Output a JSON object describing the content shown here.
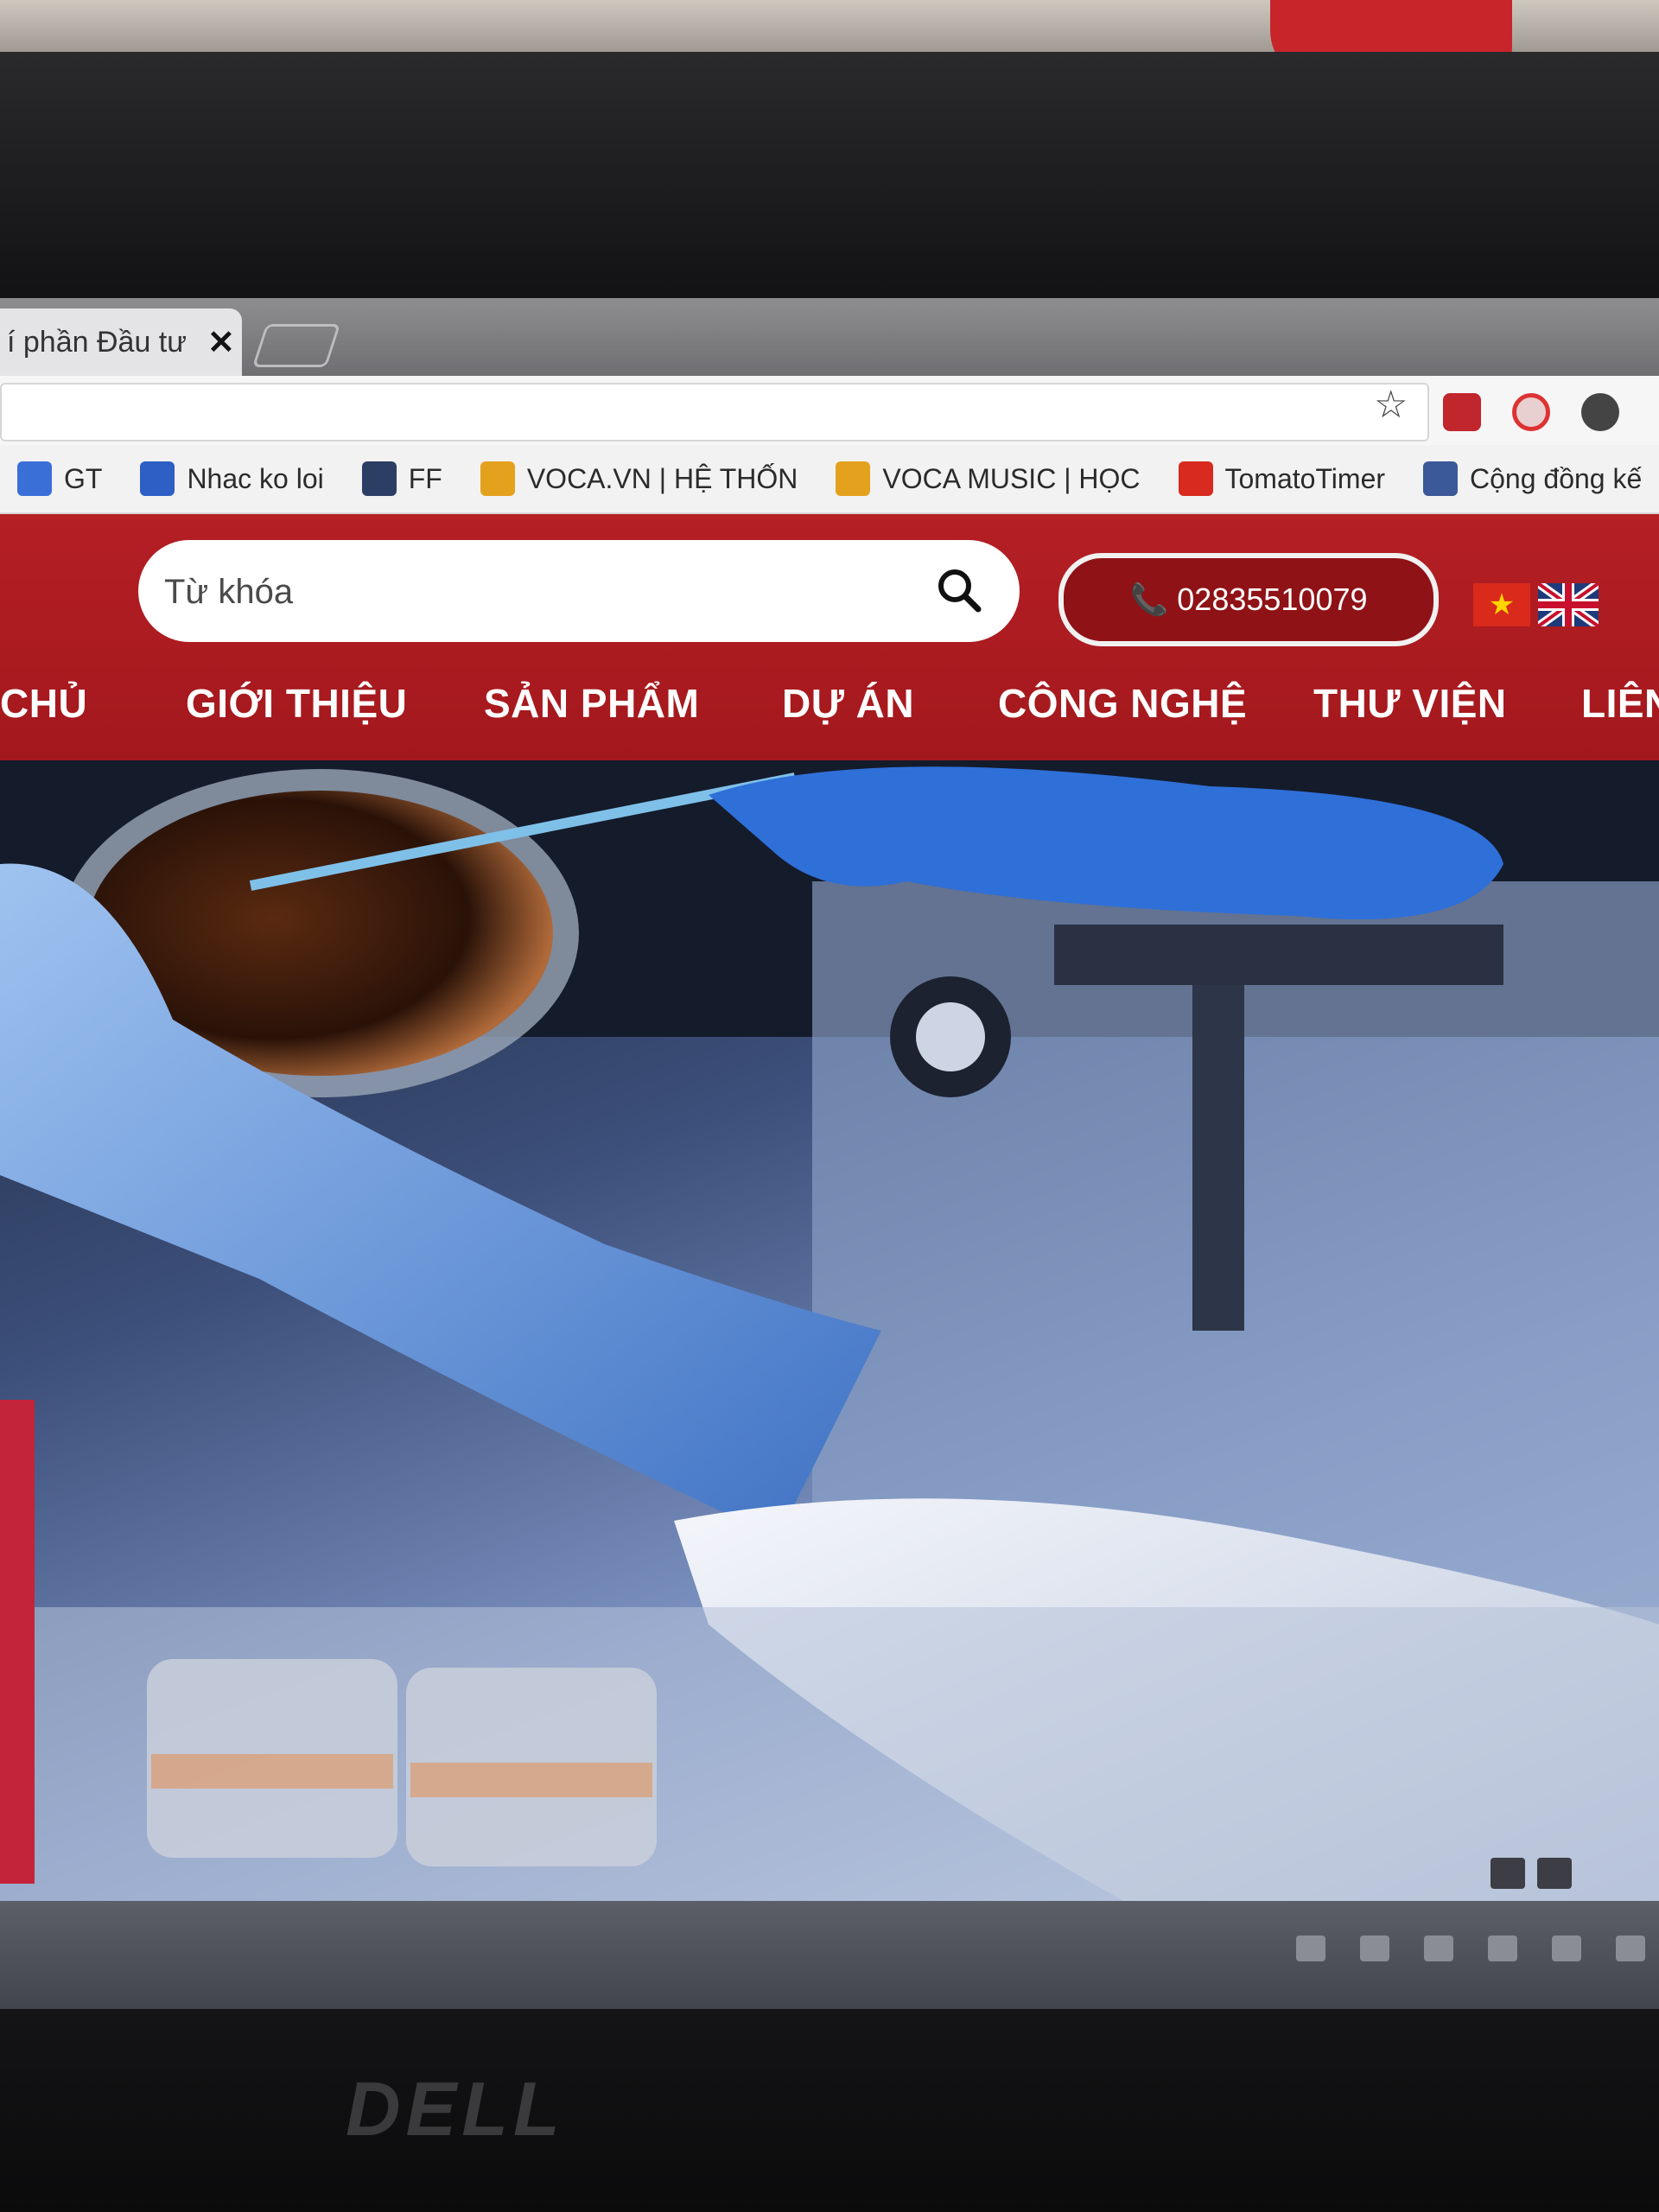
{
  "browser": {
    "tab": {
      "title": "í phần Đầu tư",
      "close_glyph": "✕"
    },
    "bookmarks": [
      {
        "label": "GT",
        "icon": "translate-icon",
        "color": "#3b6fd8"
      },
      {
        "label": "Nhac ko loi",
        "icon": "eye-icon",
        "color": "#2d5fc4"
      },
      {
        "label": "FF",
        "icon": "clapperboard-icon",
        "color": "#2c3e63"
      },
      {
        "label": "VOCA.VN | HỆ THỐN",
        "icon": "me-icon",
        "color": "#e4a11d"
      },
      {
        "label": "VOCA MUSIC | HỌC",
        "icon": "me-icon",
        "color": "#e4a11d"
      },
      {
        "label": "TomatoTimer",
        "icon": "tomato-icon",
        "color": "#d82a1e"
      },
      {
        "label": "Cộng đồng kế",
        "icon": "facebook-icon",
        "color": "#3b5998"
      }
    ]
  },
  "site": {
    "search": {
      "placeholder": "Từ khóa"
    },
    "phone": {
      "number": "02835510079"
    },
    "languages": [
      "vi",
      "en"
    ],
    "nav": [
      "CHỦ",
      "GIỚI THIỆU",
      "SẢN PHẨM",
      "DỰ ÁN",
      "CÔNG NGHỆ",
      "THƯ VIỆN",
      "LIÊN"
    ],
    "hero_image": "laboratory-petri-dish-gloved-hands"
  },
  "brand_colors": {
    "header_red": "#b41f24",
    "phone_button": "#8f1217"
  },
  "device": {
    "logo": "DELL"
  }
}
